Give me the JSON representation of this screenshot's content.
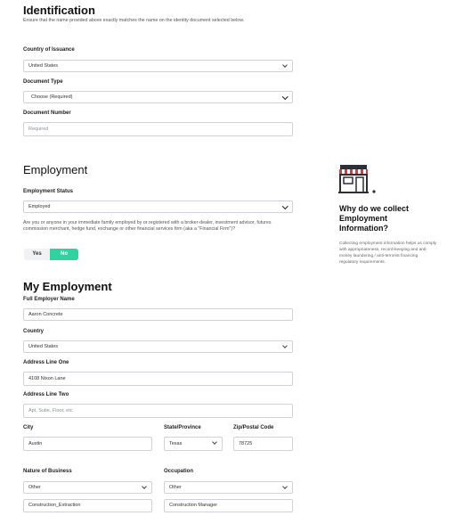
{
  "identification": {
    "title": "Identification",
    "description": "Ensure that the name provided above exactly matches the name on the identity document selected below.",
    "country_label": "Country of Issuance",
    "country_value": "United States",
    "doctype_label": "Document Type",
    "doctype_value": "Choose (Required)",
    "docnum_label": "Document Number",
    "docnum_placeholder": "Required"
  },
  "employment": {
    "title": "Employment",
    "status_label": "Employment Status",
    "status_value": "Employed",
    "question": "Are you or anyone in your immediate family employed by or registered with a broker-dealer, investment advisor, futures commission merchant, hedge fund, exchange or other financial services firm (aka a \"Financial Firm\")?",
    "yes_label": "Yes",
    "no_label": "No",
    "selected": "No"
  },
  "my_employment": {
    "title": "My Employment",
    "employer_label": "Full Employer Name",
    "employer_value": "Aaron Concrete",
    "country_label": "Country",
    "country_value": "United States",
    "address1_label": "Address Line One",
    "address1_value": "4108 Nixon Lane",
    "address2_label": "Address Line Two",
    "address2_placeholder": "Apt, Suite, Floor, etc.",
    "city_label": "City",
    "city_value": "Austin",
    "state_label": "State/Province",
    "state_value": "Texas",
    "zip_label": "Zip/Postal Code",
    "zip_value": "78725",
    "nature_label": "Nature of Business",
    "nature_value": "Other",
    "nature_other_value": "Construction_Extraction",
    "occupation_label": "Occupation",
    "occupation_value": "Other",
    "occupation_other_value": "Construction Manager"
  },
  "sidebar": {
    "icon": "storefront-icon",
    "title": "Why do we collect Employment Information?",
    "text": "Collecting employment information helps us comply with appropriateness, record-keeping and anti-money laundering / anti-terrorist financing regulatory requirements."
  },
  "colors": {
    "accent": "#2fd3a0",
    "icon_red": "#c9443b",
    "icon_dark": "#2d2f36"
  }
}
